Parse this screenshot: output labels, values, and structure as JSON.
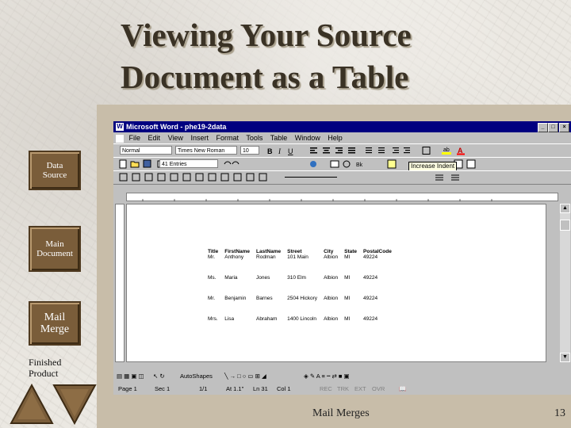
{
  "slide": {
    "title_line1": "Viewing Your Source",
    "title_line2": "Document as a Table",
    "footer_center": "Mail Merges",
    "page_number": "13"
  },
  "sidebar": {
    "data_source_line1": "Data",
    "data_source_line2": "Source",
    "main_document_line1": "Main",
    "main_document_line2": "Document",
    "mail_merge_line1": "Mail",
    "mail_merge_line2": "Merge",
    "finished_line1": "Finished",
    "finished_line2": "Product"
  },
  "word": {
    "window_title": "Microsoft Word - phe19-2data",
    "menu": [
      "File",
      "Edit",
      "View",
      "Insert",
      "Format",
      "Tools",
      "Table",
      "Window",
      "Help"
    ],
    "style_box": "Normal",
    "font_box": "Times New Roman",
    "size_box": "10",
    "merge_box": "41 Entries",
    "tooltip": "Increase Indent",
    "drawing_label": "AutoShapes",
    "status": {
      "page": "Page 1",
      "sec": "Sec 1",
      "pos": "1/1",
      "at": "At 1.1\"",
      "ln": "Ln 31",
      "col": "Col 1",
      "rec": "REC",
      "trk": "TRK",
      "ext": "EXT",
      "ovr": "OVR"
    },
    "table_headers": [
      "Title",
      "FirstName",
      "LastName",
      "Street",
      "City",
      "State",
      "PostalCode"
    ],
    "table_rows": [
      [
        "Mr.",
        "Anthony",
        "Rodman",
        "101 Main",
        "Albion",
        "MI",
        "49224"
      ],
      [
        "Ms.",
        "Maria",
        "Jones",
        "310 Elm",
        "Albion",
        "MI",
        "49224"
      ],
      [
        "Mr.",
        "Benjamin",
        "Barnes",
        "2504 Hickory",
        "Albion",
        "MI",
        "49224"
      ],
      [
        "Mrs.",
        "Lisa",
        "Abraham",
        "1400 Lincoln",
        "Albion",
        "MI",
        "49224"
      ]
    ]
  },
  "colors": {
    "title_text": "#3a3225",
    "nav_button": "#7a5d3a",
    "word_titlebar": "#000080"
  }
}
